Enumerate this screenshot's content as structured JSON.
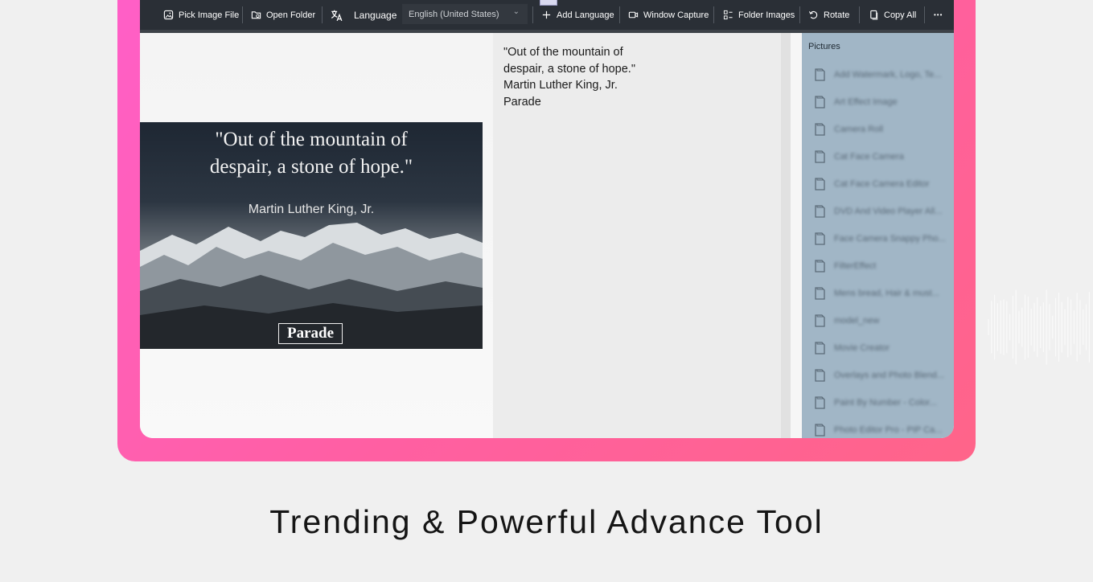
{
  "toolbar": {
    "pick_image": "Pick Image File",
    "open_folder": "Open Folder",
    "language_label": "Language",
    "language_value": "English (United States)",
    "add_language": "Add Language",
    "window_capture": "Window Capture",
    "folder_images": "Folder Images",
    "rotate": "Rotate",
    "copy_all": "Copy All",
    "more": "•••"
  },
  "image": {
    "quote_line1": "\"Out of the mountain of",
    "quote_line2": "despair, a stone of hope.\"",
    "author": "Martin Luther King, Jr.",
    "logo": "Parade"
  },
  "ocr_text": {
    "lines": [
      "\"Out of the mountain of",
      "despair, a stone of hope.\"",
      "Martin Luther King, Jr.",
      "Parade"
    ]
  },
  "sidebar": {
    "header": "Pictures",
    "items": [
      "Add Watermark, Logo, Te...",
      "Art Effect Image",
      "Camera Roll",
      "Cat Face Camera",
      "Cat Face Camera Editor",
      "DVD And Video Player All...",
      "Face Camera Snappy Pho...",
      "FilterEffect",
      "Mens bread, Hair & must...",
      "model_new",
      "Movie Creator",
      "Overlays and Photo Blend...",
      "Paint By Number - Color...",
      "Photo Editor Pro - PIP Ca..."
    ]
  },
  "caption": "Trending & Powerful Advance Tool",
  "colors": {
    "frame": "#ff5fa8",
    "toolbar": "#2a2f36",
    "sidebar": "#a1b6c6",
    "background": "#f0f0f0"
  }
}
